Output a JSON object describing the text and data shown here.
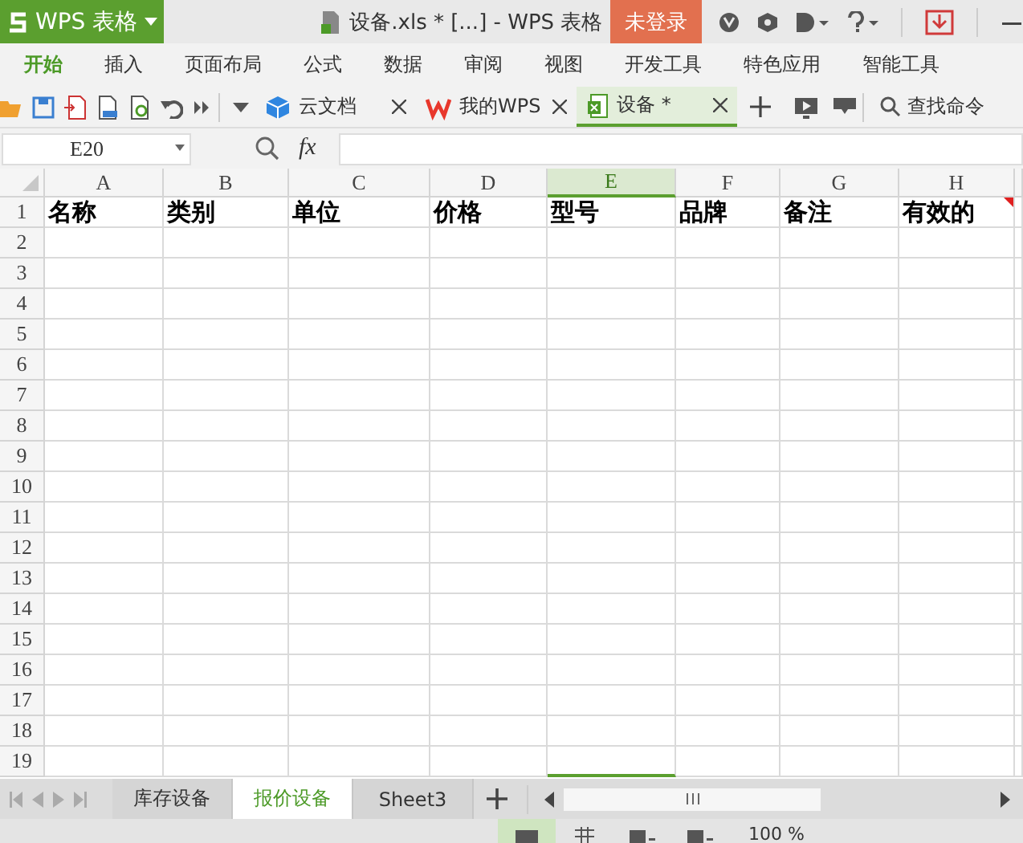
{
  "title_bar": {
    "app_button": "WPS 表格",
    "document_title": "设备.xls * [...] - WPS 表格",
    "login_button": "未登录"
  },
  "ribbon_tabs": [
    {
      "label": "开始",
      "selected": true
    },
    {
      "label": "插入",
      "selected": false
    },
    {
      "label": "页面布局",
      "selected": false
    },
    {
      "label": "公式",
      "selected": false
    },
    {
      "label": "数据",
      "selected": false
    },
    {
      "label": "审阅",
      "selected": false
    },
    {
      "label": "视图",
      "selected": false
    },
    {
      "label": "开发工具",
      "selected": false
    },
    {
      "label": "特色应用",
      "selected": false
    },
    {
      "label": "智能工具",
      "selected": false
    }
  ],
  "document_tabs": [
    {
      "label": "云文档",
      "kind": "cloud",
      "selected": false
    },
    {
      "label": "我的WPS",
      "kind": "wps",
      "selected": false
    },
    {
      "label": "设备 *",
      "kind": "sheet",
      "selected": true
    }
  ],
  "search": {
    "placeholder": "查找命令"
  },
  "formula_bar": {
    "name_box": "E20",
    "function_label": "fx"
  },
  "columns": [
    {
      "label": "A",
      "selected": false
    },
    {
      "label": "B",
      "selected": false
    },
    {
      "label": "C",
      "selected": false
    },
    {
      "label": "D",
      "selected": false
    },
    {
      "label": "E",
      "selected": true
    },
    {
      "label": "F",
      "selected": false
    },
    {
      "label": "G",
      "selected": false
    },
    {
      "label": "H",
      "selected": false
    }
  ],
  "row_numbers": [
    "1",
    "2",
    "3",
    "4",
    "5",
    "6",
    "7",
    "8",
    "9",
    "10",
    "11",
    "12",
    "13",
    "14",
    "15",
    "16",
    "17",
    "18",
    "19"
  ],
  "header_row": [
    {
      "text": "名称",
      "comment": false
    },
    {
      "text": "类别",
      "comment": false
    },
    {
      "text": "单位",
      "comment": false
    },
    {
      "text": "价格",
      "comment": false
    },
    {
      "text": "型号",
      "comment": false
    },
    {
      "text": "品牌",
      "comment": false
    },
    {
      "text": "备注",
      "comment": false
    },
    {
      "text": "有效的",
      "comment": true
    }
  ],
  "sheet_tabs": [
    {
      "label": "库存设备",
      "selected": false
    },
    {
      "label": "报价设备",
      "selected": true
    },
    {
      "label": "Sheet3",
      "selected": false
    }
  ],
  "status_bar": {
    "zoom": "100 %"
  }
}
